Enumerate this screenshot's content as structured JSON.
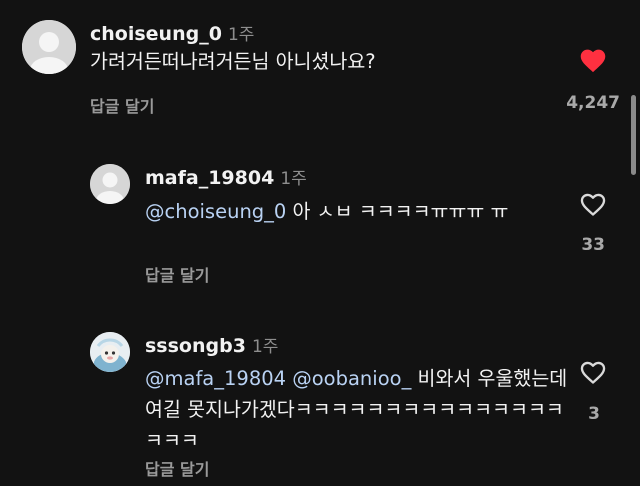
{
  "comments": [
    {
      "username": "choiseung_0",
      "time": "1주",
      "mentions": "",
      "text": "가려거든떠나려거든님 아니셨나요?",
      "reply_label": "답글 달기",
      "likes": "4,247",
      "liked": true
    },
    {
      "username": "mafa_19804",
      "time": "1주",
      "mentions": "@choiseung_0",
      "text": " 아 ㅅㅂ ㅋㅋㅋㅋㅠㅠㅠ ㅠ",
      "reply_label": "답글 달기",
      "likes": "33",
      "liked": false
    },
    {
      "username": "sssongb3",
      "time": "1주",
      "mentions": "@mafa_19804 @oobanioo_",
      "text": " 비와서 우울했는데 여길 못지나가겠다ㅋㅋㅋㅋㅋㅋㅋㅋㅋㅋㅋㅋㅋㅋㅋㅋㅋㅋ",
      "reply_label": "답글 달기",
      "likes": "3",
      "liked": false
    }
  ],
  "colors": {
    "background": "#121212",
    "mention": "#b9d2f3",
    "liked_heart": "#ff3040",
    "muted": "#9a9a9a"
  },
  "icons": [
    "heart-filled-icon",
    "heart-outline-icon",
    "avatar-placeholder",
    "avatar-image"
  ]
}
